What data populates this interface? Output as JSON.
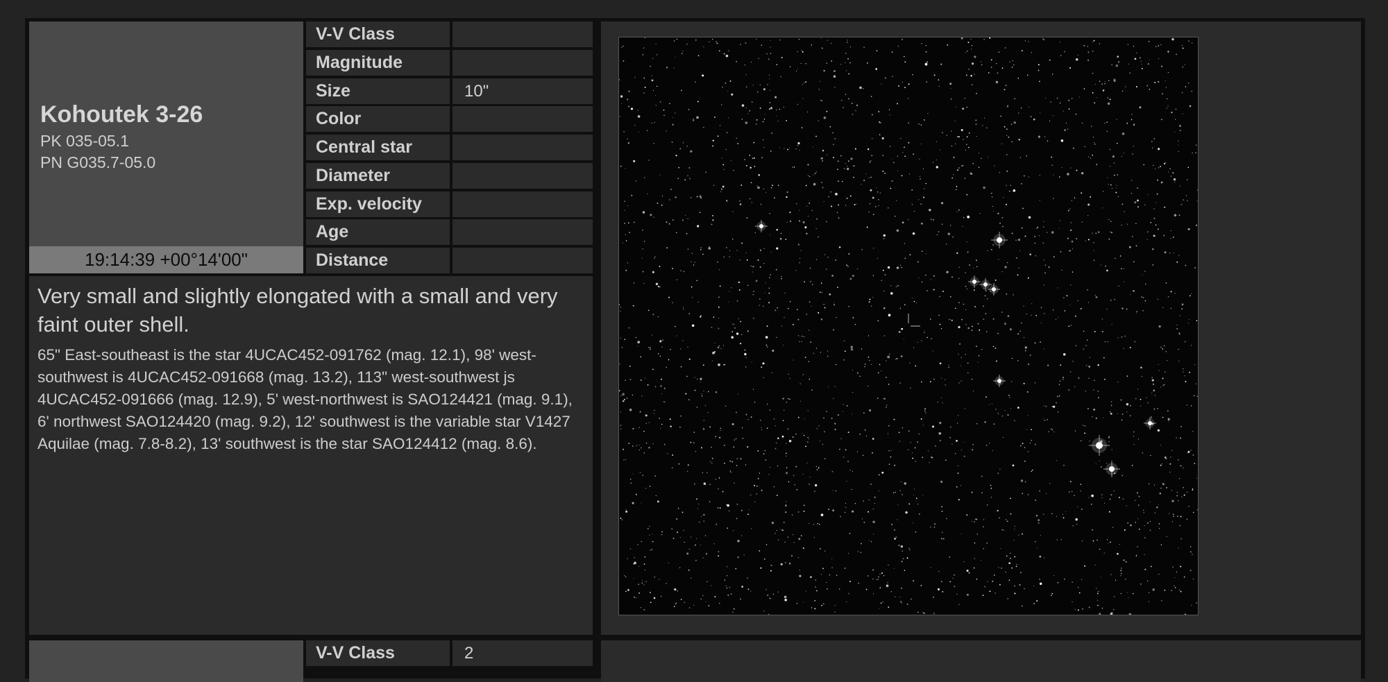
{
  "entries": [
    {
      "name": "Kohoutek 3-26",
      "catalog_ids": [
        "PK 035-05.1",
        "PN G035.7-05.0"
      ],
      "coordinates": "19:14:39 +00°14'00\"",
      "properties": [
        {
          "label": "V-V Class",
          "value": ""
        },
        {
          "label": "Magnitude",
          "value": ""
        },
        {
          "label": "Size",
          "value": "10\""
        },
        {
          "label": "Color",
          "value": ""
        },
        {
          "label": "Central star",
          "value": ""
        },
        {
          "label": "Diameter",
          "value": ""
        },
        {
          "label": "Exp. velocity",
          "value": ""
        },
        {
          "label": "Age",
          "value": ""
        },
        {
          "label": "Distance",
          "value": ""
        }
      ],
      "description_lead": "Very small and slightly elongated with a small and very faint outer shell.",
      "description_body": "65\" East-southeast is the star 4UCAC452-091762 (mag. 12.1), 98' west-southwest is 4UCAC452-091668 (mag. 13.2), 113\" west-southwest js 4UCAC452-091666 (mag. 12.9), 5' west-northwest is SAO124421 (mag. 9.1), 6' northwest SAO124420 (mag. 9.2), 12' southwest is the variable star V1427 Aquilae (mag. 7.8-8.2), 13' southwest is the star SAO124412 (mag. 8.6)."
    },
    {
      "properties": [
        {
          "label": "V-V Class",
          "value": "2"
        }
      ]
    }
  ],
  "colors": {
    "page_background": "#232323",
    "panel_background": "#2b2b2b",
    "title_box": "#4a4a4a",
    "coords_bar": "#7a7a7a",
    "sky_background": "#050505"
  }
}
